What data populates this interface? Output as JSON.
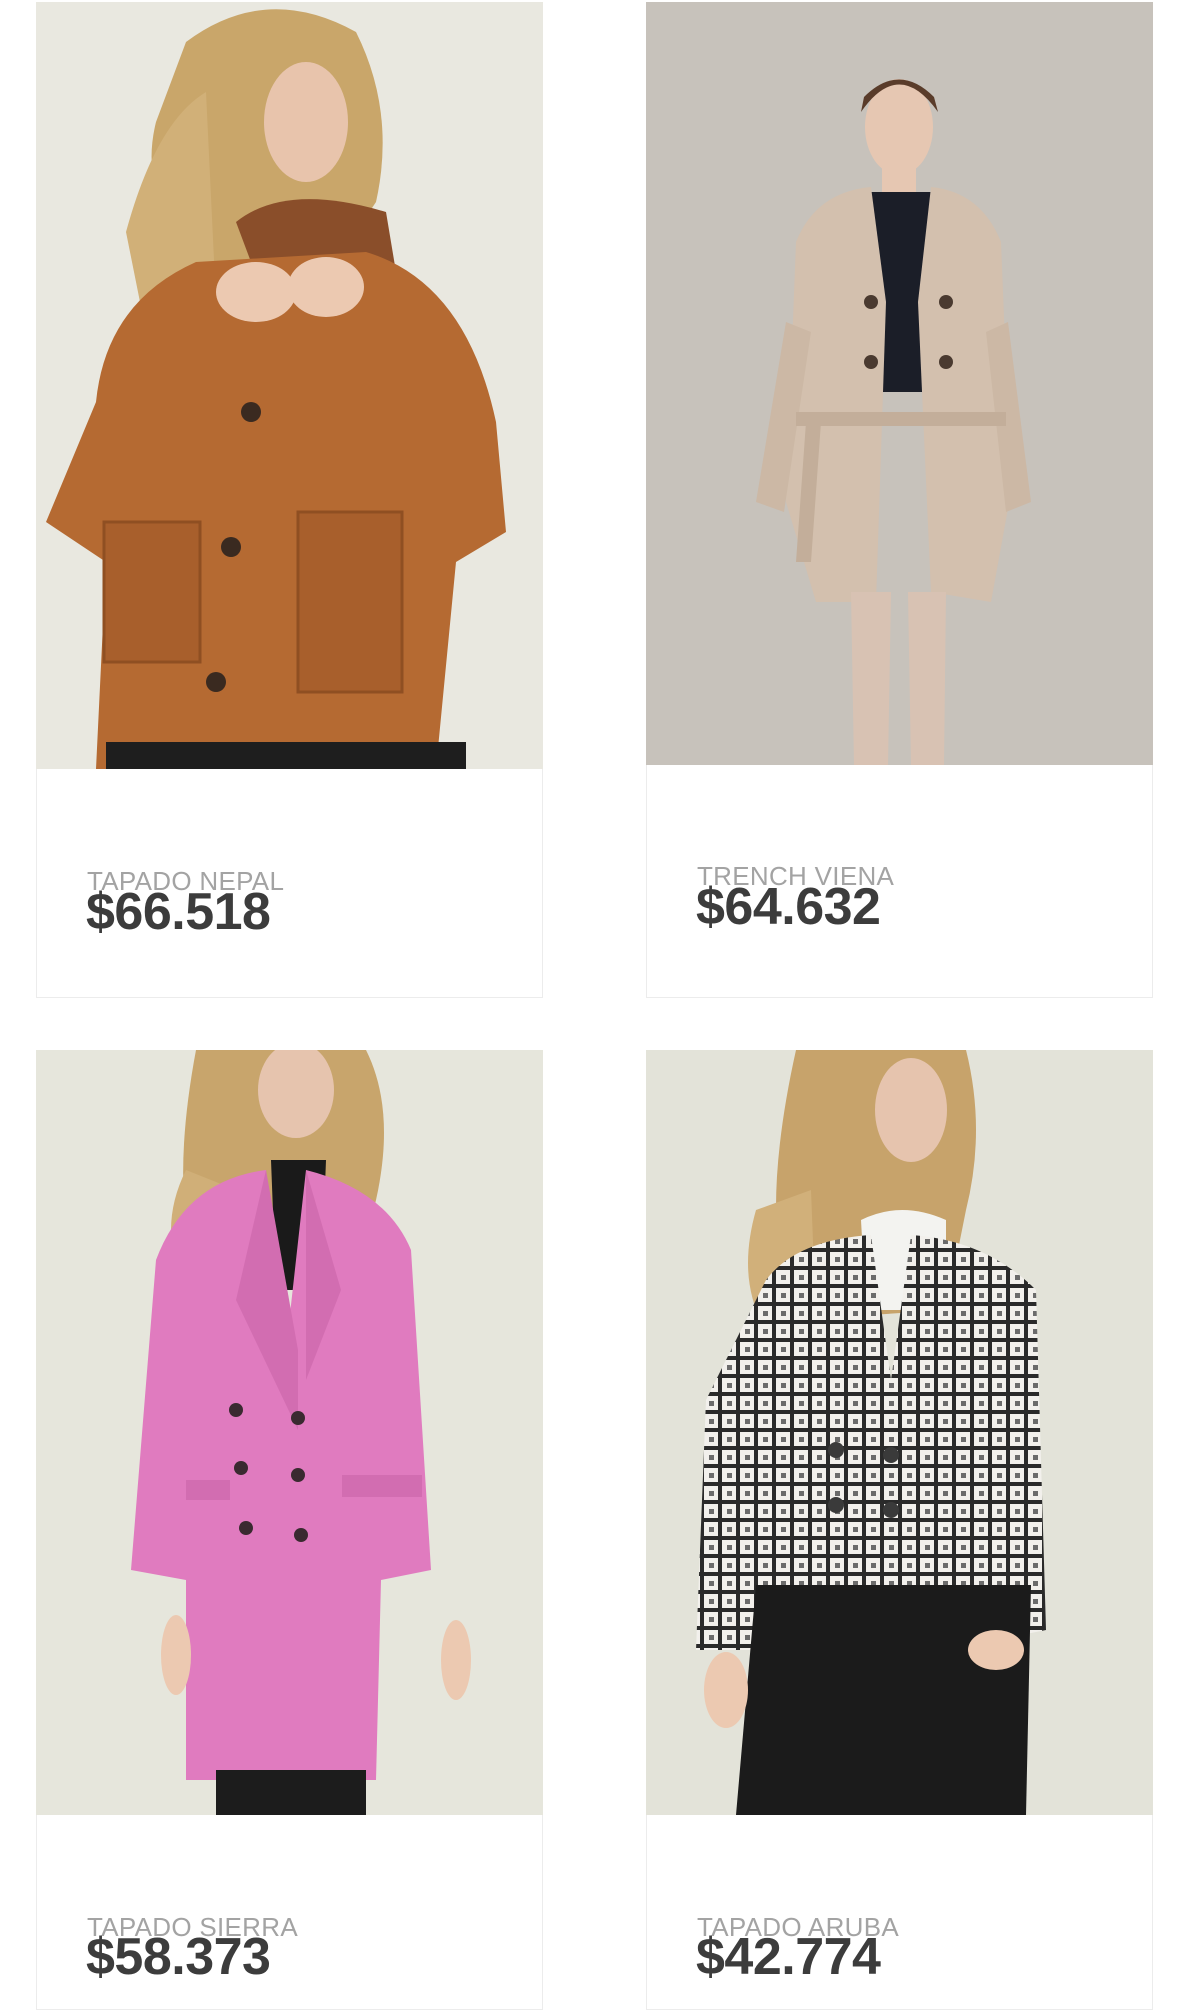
{
  "products": [
    {
      "name": "TAPADO NEPAL",
      "price": "$66.518",
      "image_desc": "mustard-wool-coat-photo",
      "coat_color": "#b56a32",
      "bg_color": "#e9e8e0"
    },
    {
      "name": "TRENCH VIENA",
      "price": "$64.632",
      "image_desc": "beige-trench-coat-photo",
      "coat_color": "#d3c0ae",
      "bg_color": "#c7c2bb"
    },
    {
      "name": "TAPADO SIERRA",
      "price": "$58.373",
      "image_desc": "pink-double-breasted-coat-photo",
      "coat_color": "#e07bbf",
      "bg_color": "#e6e6dc"
    },
    {
      "name": "TAPADO ARUBA",
      "price": "$42.774",
      "image_desc": "tweed-cropped-jacket-photo",
      "coat_color": "#8a8a8a",
      "bg_color": "#e3e3d9"
    }
  ]
}
